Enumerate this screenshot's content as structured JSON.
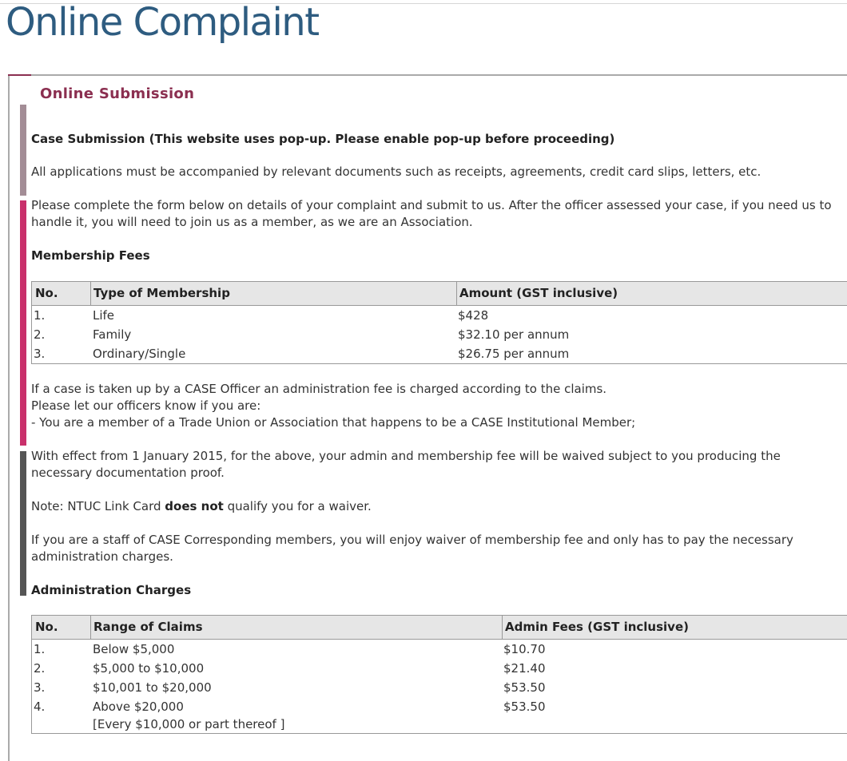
{
  "page": {
    "title": "Online Complaint"
  },
  "section": {
    "title": "Online Submission"
  },
  "content": {
    "case_heading": "Case Submission (This website uses pop-up. Please enable pop-up before proceeding)",
    "documents_note": "All applications must be accompanied by relevant documents such as receipts, agreements, credit card slips, letters, etc.",
    "intro_line1": "Please complete the form below on details of your complaint and submit to us. After the officer assessed your case, if you need us to",
    "intro_line2": "handle it, you will need to join us as a member, as we are an Association.",
    "membership_heading": "Membership Fees",
    "admin_fee_line1": "If a case is taken up by a CASE Officer an administration fee is charged according to the claims.",
    "admin_fee_line2": "Please let our officers know if you are:",
    "admin_fee_line3": "- You are a member of a Trade Union or Association that happens to be a CASE Institutional Member;",
    "waiver_line1": "With effect from 1 January 2015, for the above, your admin and membership fee will be waived subject to you producing the",
    "waiver_line2": "necessary documentation proof.",
    "note_prefix": "Note: NTUC Link Card ",
    "note_bold": "does not",
    "note_suffix": " qualify you for a waiver.",
    "staff_line1": "If you are a staff of CASE Corresponding members, you will enjoy waiver of membership fee and only has to pay the necessary",
    "staff_line2": "administration charges.",
    "admin_heading": "Administration Charges"
  },
  "membership_table": {
    "headers": [
      "No.",
      "Type of Membership",
      "Amount (GST inclusive)"
    ],
    "rows": [
      [
        "1.",
        "Life",
        "$428"
      ],
      [
        "2.",
        "Family",
        "$32.10 per annum"
      ],
      [
        "3.",
        "Ordinary/Single",
        "$26.75 per annum"
      ]
    ]
  },
  "admin_table": {
    "headers": [
      "No.",
      "Range of Claims",
      "Admin Fees (GST inclusive)"
    ],
    "rows": [
      [
        "1.",
        "Below $5,000",
        "$10.70"
      ],
      [
        "2.",
        "$5,000 to $10,000",
        "$21.40"
      ],
      [
        "3.",
        "$10,001 to $20,000",
        "$53.50"
      ],
      [
        "4.",
        "Above $20,000",
        "$53.50"
      ]
    ],
    "row4_note": "[Every $10,000 or part thereof ]"
  },
  "colors": {
    "title": "#2e5c80",
    "section_title": "#8b2f50",
    "bar_top": "#a38d96",
    "bar_middle": "#c9306b",
    "bar_bottom": "#555555"
  }
}
